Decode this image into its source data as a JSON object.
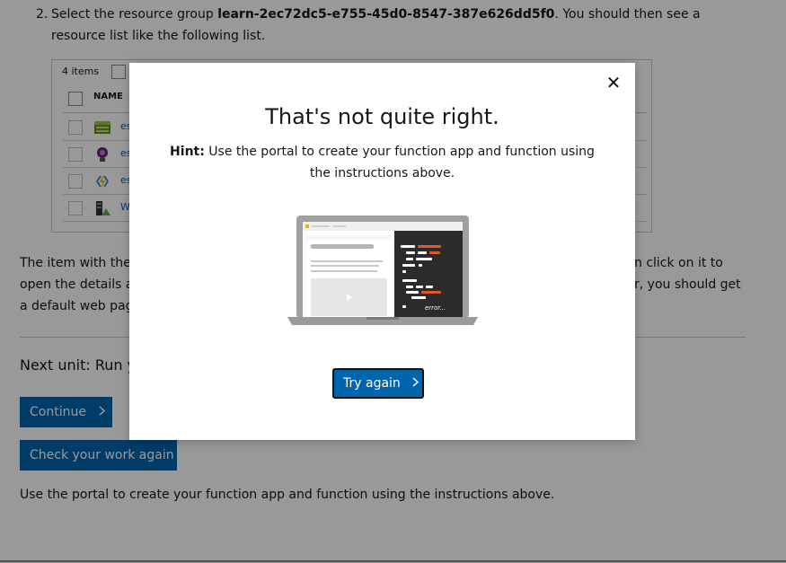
{
  "step": {
    "number": "2.",
    "prefix": "Select the resource group ",
    "group_name": "learn-2ec72dc5-e755-45d0-8547-387e626dd5f0",
    "suffix": ". You should then see a resource list like the following list."
  },
  "resource_list": {
    "count": "4 items",
    "column_name": "NAME",
    "rows": [
      {
        "icon": "storage-icon",
        "name": "es"
      },
      {
        "icon": "insights-bulb-icon",
        "name": "es"
      },
      {
        "icon": "function-app-icon",
        "name": "es"
      },
      {
        "icon": "app-service-plan-icon",
        "name": "W"
      }
    ]
  },
  "paragraph": {
    "part1": "The item with the l",
    "part2": "n click on it to",
    "part3": "open the details ab",
    "part4": "r, you should get",
    "part5": "a default web page"
  },
  "next_unit": {
    "label": "Next unit: Run y"
  },
  "buttons": {
    "continue": "Continue",
    "check": "Check your work again"
  },
  "bottom_text": "Use the portal to create your function app and function using the instructions above.",
  "modal": {
    "close_glyph": "✕",
    "title": "That's not quite right.",
    "hint_label": "Hint:",
    "hint_text": " Use the portal to create your function app and function using the instructions above.",
    "illustration_text": "error...",
    "try_again": "Try again"
  },
  "colors": {
    "primary": "#0065ad",
    "overlay": "rgba(0,0,0,0.40)",
    "link": "#0060b0"
  }
}
